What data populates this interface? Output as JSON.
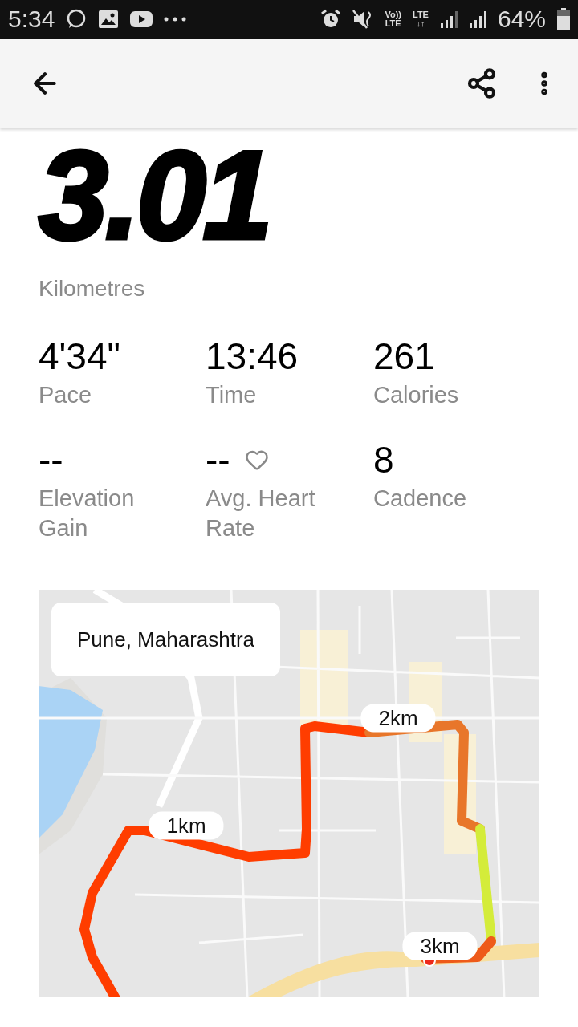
{
  "status_bar": {
    "time": "5:34",
    "indicators": [
      {
        "top": "Vo))",
        "bottom": "LTE"
      },
      {
        "top": "LTE",
        "bottom": "↓↑"
      }
    ],
    "battery": "64%"
  },
  "distance": {
    "value": "3.01",
    "unit": "Kilometres"
  },
  "stats": [
    {
      "value": "4'34\"",
      "label": "Pace",
      "kind": "plain"
    },
    {
      "value": "13:46",
      "label": "Time",
      "kind": "plain"
    },
    {
      "value": "261",
      "label": "Calories",
      "kind": "plain"
    },
    {
      "value": "--",
      "label": "Elevation Gain",
      "kind": "plain"
    },
    {
      "value": "--",
      "label": "Avg. Heart Rate",
      "kind": "heart"
    },
    {
      "value": "8",
      "label": "Cadence",
      "kind": "plain"
    }
  ],
  "map": {
    "location": "Pune, Maharashtra",
    "markers": [
      {
        "label": "1km"
      },
      {
        "label": "2km"
      },
      {
        "label": "3km"
      }
    ]
  }
}
